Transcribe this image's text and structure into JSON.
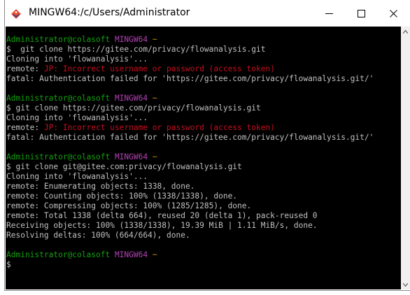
{
  "window": {
    "title": "MINGW64:/c/Users/Administrator",
    "controls": {
      "minimize_icon": "minimize-icon",
      "maximize_icon": "maximize-icon",
      "close_icon": "close-icon"
    }
  },
  "colors": {
    "background": "#000000",
    "text": "#c0c0c0",
    "user_host": "#13a10e",
    "mingw": "#b541b5",
    "path": "#c19c00",
    "error": "#c50f1f"
  },
  "terminal": {
    "blocks": [
      {
        "prompt": {
          "user_host": "Administrator@colasoft",
          "env": "MINGW64",
          "path": "~"
        },
        "command": "$  git clone https://gitee.com/privacy/flowanalysis.git",
        "output": [
          {
            "prefix": "Cloning into 'flowanalysis'...",
            "error": ""
          },
          {
            "prefix": "remote: ",
            "error": "JP: Incorrect username or password (access token)"
          },
          {
            "prefix": "fatal: Authentication failed for 'https://gitee.com/privacy/flowanalysis.git/'",
            "error": ""
          }
        ]
      },
      {
        "prompt": {
          "user_host": "Administrator@colasoft",
          "env": "MINGW64",
          "path": "~"
        },
        "command": "$ git clone https://gitee.com/privacy/flowanalysis.git",
        "output": [
          {
            "prefix": "Cloning into 'flowanalysis'...",
            "error": ""
          },
          {
            "prefix": "remote: ",
            "error": "JP: Incorrect username or password (access token)"
          },
          {
            "prefix": "fatal: Authentication failed for 'https://gitee.com/privacy/flowanalysis.git/'",
            "error": ""
          }
        ]
      },
      {
        "prompt": {
          "user_host": "Administrator@colasoft",
          "env": "MINGW64",
          "path": "~"
        },
        "command": "$ git clone git@gitee.com:privacy/flowanalysis.git",
        "output": [
          {
            "prefix": "Cloning into 'flowanalysis'...",
            "error": ""
          },
          {
            "prefix": "remote: Enumerating objects: 1338, done.",
            "error": ""
          },
          {
            "prefix": "remote: Counting objects: 100% (1338/1338), done.",
            "error": ""
          },
          {
            "prefix": "remote: Compressing objects: 100% (1285/1285), done.",
            "error": ""
          },
          {
            "prefix": "remote: Total 1338 (delta 664), reused 20 (delta 1), pack-reused 0",
            "error": ""
          },
          {
            "prefix": "Receiving objects: 100% (1338/1338), 19.39 MiB | 1.11 MiB/s, done.",
            "error": ""
          },
          {
            "prefix": "Resolving deltas: 100% (664/664), done.",
            "error": ""
          }
        ]
      },
      {
        "prompt": {
          "user_host": "Administrator@colasoft",
          "env": "MINGW64",
          "path": "~"
        },
        "command": "$",
        "output": []
      }
    ]
  }
}
